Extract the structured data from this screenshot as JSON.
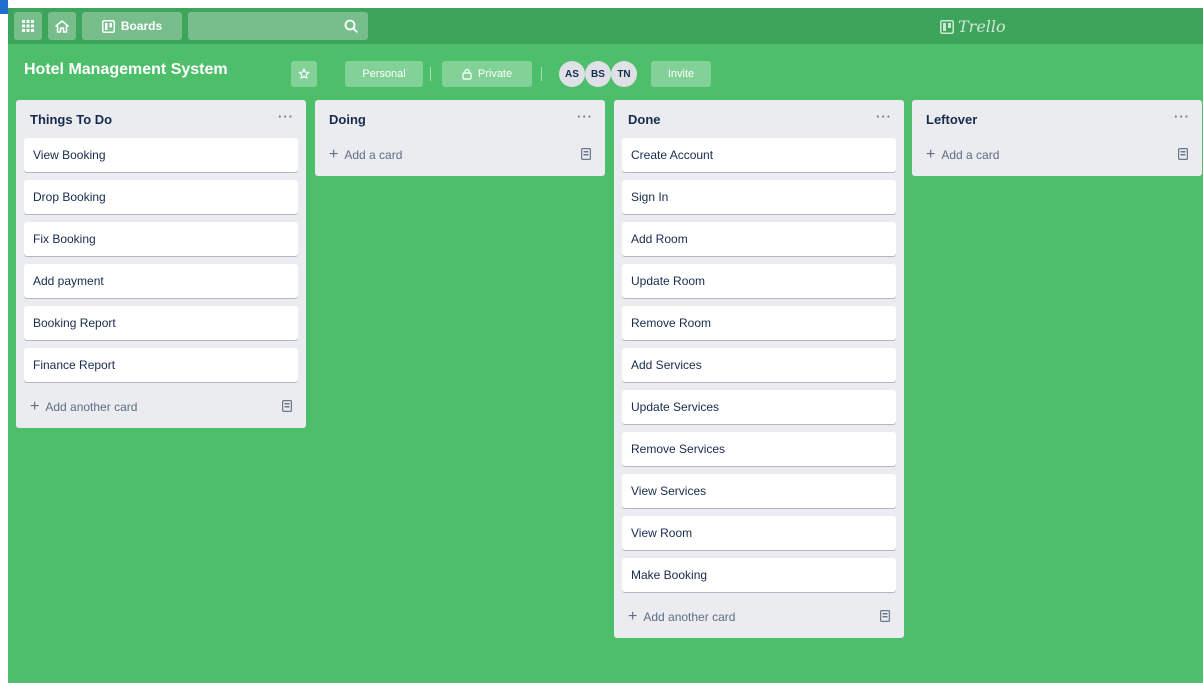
{
  "topbar": {
    "apps_icon": "apps-grid-icon",
    "home_icon": "home-icon",
    "boards_label": "Boards",
    "search_placeholder": "",
    "logo_text": "Trello"
  },
  "board": {
    "title": "Hotel Management System",
    "star_icon": "star-icon",
    "team_label": "Personal",
    "visibility_label": "Private",
    "members": [
      "AS",
      "BS",
      "TN"
    ],
    "invite_label": "Invite"
  },
  "lists": [
    {
      "title": "Things To Do",
      "cards": [
        "View Booking",
        "Drop Booking",
        "Fix Booking",
        "Add payment",
        "Booking Report",
        "Finance Report"
      ],
      "add_label": "Add another card"
    },
    {
      "title": "Doing",
      "cards": [],
      "add_label": "Add a card"
    },
    {
      "title": "Done",
      "cards": [
        "Create Account",
        "Sign In",
        "Add Room",
        "Update Room",
        "Remove Room",
        "Add Services",
        "Update Services",
        "Remove Services",
        "View Services",
        "View Room",
        "Make Booking"
      ],
      "add_label": "Add another card"
    },
    {
      "title": "Leftover",
      "cards": [],
      "add_label": "Add a card"
    }
  ],
  "colors": {
    "board_bg": "#4dbf6b",
    "topbar_bg": "#3ea35b",
    "list_bg": "#ebecf0",
    "card_bg": "#ffffff"
  }
}
